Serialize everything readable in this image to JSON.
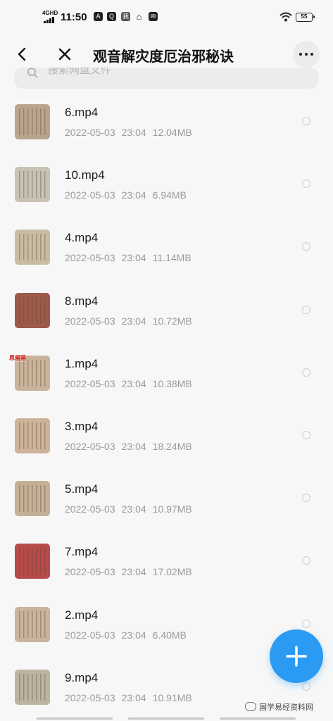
{
  "status_bar": {
    "network": "4GHD",
    "time": "11:50",
    "icon_labels": [
      "A",
      "Q",
      "我",
      "⌂",
      "✉"
    ],
    "battery": "55"
  },
  "header": {
    "title": "观音解灾度厄治邪秘诀",
    "back_icon": "chevron-left-icon",
    "close_icon": "close-icon",
    "more_icon": "more-horizontal-icon"
  },
  "search": {
    "placeholder": "搜索网盘文件"
  },
  "files": [
    {
      "name": "6.mp4",
      "date": "2022-05-03",
      "time": "23:04",
      "size": "12.04MB",
      "thumb_color": "#b9a58d"
    },
    {
      "name": "10.mp4",
      "date": "2022-05-03",
      "time": "23:04",
      "size": "6.94MB",
      "thumb_color": "#c8c2b3"
    },
    {
      "name": "4.mp4",
      "date": "2022-05-03",
      "time": "23:04",
      "size": "11.14MB",
      "thumb_color": "#c9bca5"
    },
    {
      "name": "8.mp4",
      "date": "2022-05-03",
      "time": "23:04",
      "size": "10.72MB",
      "thumb_color": "#9d5a4a"
    },
    {
      "name": "1.mp4",
      "date": "2022-05-03",
      "time": "23:04",
      "size": "10.38MB",
      "thumb_color": "#c9b39a"
    },
    {
      "name": "3.mp4",
      "date": "2022-05-03",
      "time": "23:04",
      "size": "18.24MB",
      "thumb_color": "#cdb399"
    },
    {
      "name": "5.mp4",
      "date": "2022-05-03",
      "time": "23:04",
      "size": "10.97MB",
      "thumb_color": "#c4b096"
    },
    {
      "name": "7.mp4",
      "date": "2022-05-03",
      "time": "23:04",
      "size": "17.02MB",
      "thumb_color": "#b84a4a"
    },
    {
      "name": "2.mp4",
      "date": "2022-05-03",
      "time": "23:04",
      "size": "6.40MB",
      "thumb_color": "#c8b49e"
    },
    {
      "name": "9.mp4",
      "date": "2022-05-03",
      "time": "23:04",
      "size": "10.91MB",
      "thumb_color": "#bdb3a2"
    }
  ],
  "stamp_text": "思留鬲",
  "fab": {
    "icon": "plus-icon",
    "color": "#2a9af2"
  },
  "watermark": "国学易经资料网"
}
